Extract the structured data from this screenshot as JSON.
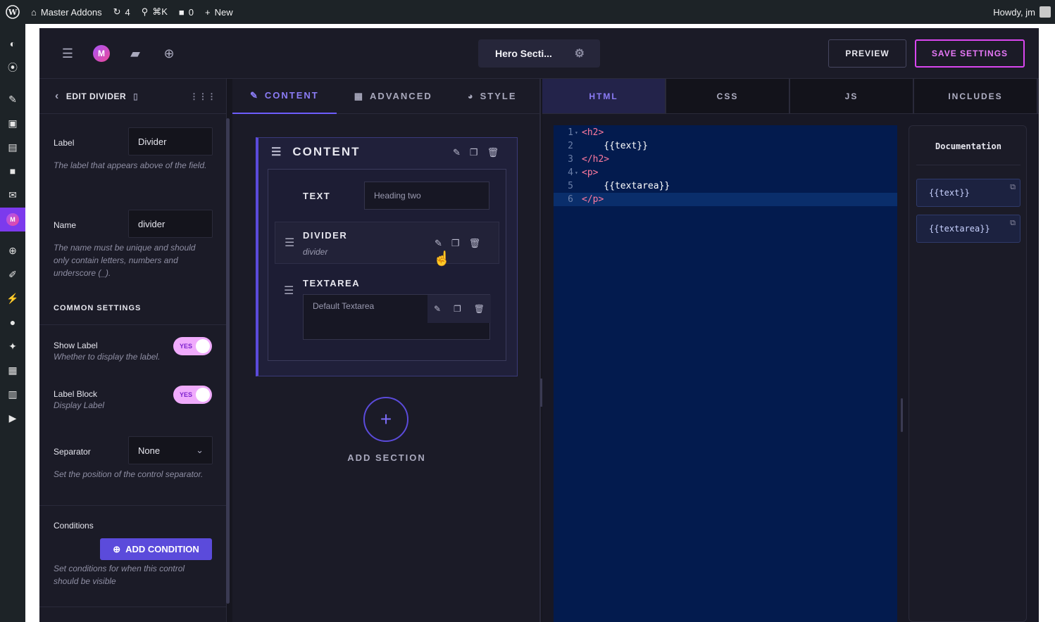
{
  "admin_bar": {
    "site_name": "Master Addons",
    "updates_count": "4",
    "search_shortcut": "⌘K",
    "comments_count": "0",
    "new_label": "New",
    "greeting": "Howdy, jm"
  },
  "header": {
    "section_title": "Hero Secti...",
    "preview_label": "PREVIEW",
    "save_label": "SAVE SETTINGS",
    "logo_letter": "M"
  },
  "left_panel": {
    "title": "EDIT DIVIDER",
    "label_field": {
      "label": "Label",
      "value": "Divider",
      "help": "The label that appears above of the field."
    },
    "name_field": {
      "label": "Name",
      "value": "divider",
      "help": "The name must be unique and should only contain letters, numbers and underscore (_)."
    },
    "common_settings": "COMMON SETTINGS",
    "show_label": {
      "label": "Show Label",
      "help": "Whether to display the label.",
      "toggle": "YES"
    },
    "label_block": {
      "label": "Label Block",
      "help": "Display Label",
      "toggle": "YES"
    },
    "separator": {
      "label": "Separator",
      "value": "None",
      "help": "Set the position of the control separator."
    },
    "conditions": {
      "label": "Conditions",
      "button": "ADD CONDITION",
      "help": "Set conditions for when this control should be visible"
    }
  },
  "mid_panel": {
    "tabs": [
      {
        "label": "CONTENT",
        "icon": "pencil-icon"
      },
      {
        "label": "ADVANCED",
        "icon": "grid-icon"
      },
      {
        "label": "STYLE",
        "icon": "palette-icon"
      }
    ],
    "section_title": "CONTENT",
    "text_field": {
      "label": "TEXT",
      "placeholder": "Heading two"
    },
    "divider_field": {
      "label": "DIVIDER",
      "sub": "divider"
    },
    "textarea_field": {
      "label": "TEXTAREA",
      "placeholder": "Default Textarea"
    },
    "add_section": "ADD SECTION"
  },
  "code_panel": {
    "tabs": [
      "HTML",
      "CSS",
      "JS",
      "INCLUDES"
    ],
    "lines": [
      {
        "num": "1",
        "parts": [
          {
            "cls": "tag",
            "text": "<h2>"
          }
        ]
      },
      {
        "num": "2",
        "parts": [
          {
            "cls": "tpl",
            "text": "    {{text}}"
          }
        ]
      },
      {
        "num": "3",
        "parts": [
          {
            "cls": "tag",
            "text": "</h2>"
          }
        ]
      },
      {
        "num": "4",
        "parts": [
          {
            "cls": "tag",
            "text": "<p>"
          }
        ]
      },
      {
        "num": "5",
        "parts": [
          {
            "cls": "tpl",
            "text": "    {{textarea}}"
          }
        ]
      },
      {
        "num": "6",
        "parts": [
          {
            "cls": "tag",
            "text": "</p>"
          }
        ]
      }
    ],
    "doc_title": "Documentation",
    "doc_vars": [
      "{{text}}",
      "{{textarea}}"
    ]
  },
  "colors": {
    "accent": "#6d5dfc",
    "save_border": "#d946ef",
    "editor_bg": "#031b4e",
    "tag": "#ff7a9e"
  }
}
